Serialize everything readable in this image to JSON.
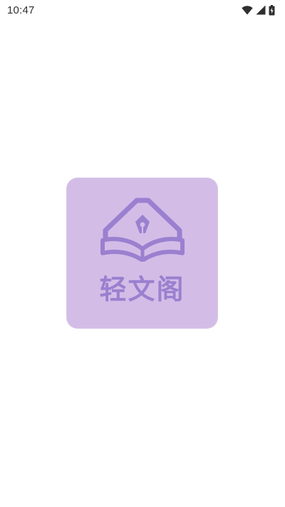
{
  "status_bar": {
    "time": "10:47",
    "icons": [
      "wifi-icon",
      "signal-icon",
      "battery-icon"
    ]
  },
  "splash": {
    "logo_text": "轻文阁",
    "colors": {
      "card_background": "#d3bde7",
      "logo_color": "#9a80cf"
    }
  }
}
